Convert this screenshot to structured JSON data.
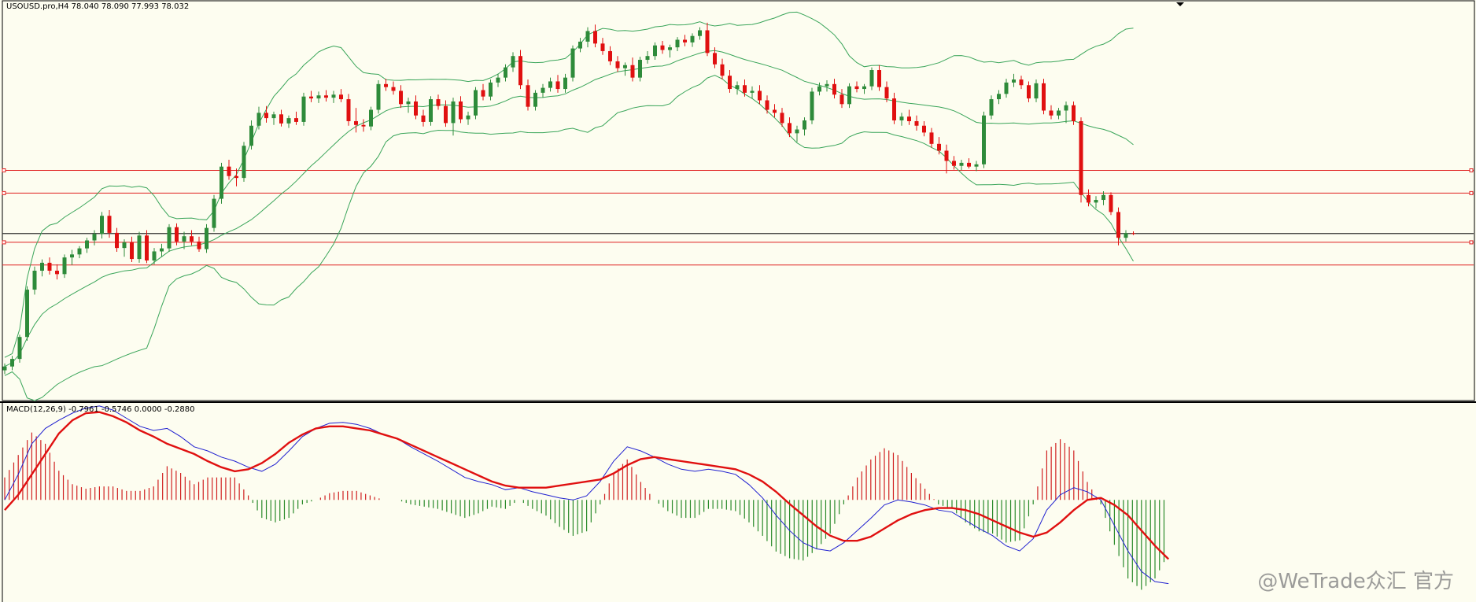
{
  "main_pane": {
    "title": "USOUSD.pro,H4  78.040 78.090 77.993 78.032"
  },
  "macd_pane": {
    "title": "MACD(12,26,9) -0.7961 -0.5746 0.0000 -0.2880"
  },
  "watermark": "@WeTrade众汇 官方",
  "colors": {
    "background": "#fdfdf0",
    "bull_candle": "#2e8b3a",
    "bear_candle": "#e01010",
    "bollinger": "#3aa55a",
    "level_line": "#e02020",
    "current_price_line": "#303030",
    "macd_line": "#2020d0",
    "signal_line": "#e01010",
    "hist_positive": "#d02020",
    "hist_negative": "#2a8a2a"
  },
  "chart_data": [
    {
      "type": "candlestick",
      "title": "USOUSD.pro,H4",
      "last_bar": {
        "open": 78.04,
        "high": 78.09,
        "low": 77.993,
        "close": 78.032
      },
      "ylim": [
        73.6,
        84.2
      ],
      "indicators": [
        "Bollinger Bands"
      ],
      "horizontal_levels": [
        79.7,
        79.1,
        77.8,
        77.2
      ],
      "current_price": 78.032,
      "candles": [
        [
          74.42,
          74.6,
          74.32,
          74.52
        ],
        [
          74.52,
          74.8,
          74.42,
          74.72
        ],
        [
          74.72,
          75.36,
          74.62,
          75.3
        ],
        [
          75.3,
          76.64,
          75.2,
          76.55
        ],
        [
          76.55,
          77.16,
          76.42,
          77.05
        ],
        [
          77.05,
          77.35,
          76.9,
          77.26
        ],
        [
          77.26,
          77.4,
          76.95,
          77.05
        ],
        [
          77.05,
          77.22,
          76.82,
          76.96
        ],
        [
          76.96,
          77.48,
          76.86,
          77.4
        ],
        [
          77.4,
          77.6,
          77.2,
          77.48
        ],
        [
          77.48,
          77.7,
          77.38,
          77.64
        ],
        [
          77.64,
          77.92,
          77.52,
          77.85
        ],
        [
          77.85,
          78.12,
          77.72,
          78.02
        ],
        [
          78.02,
          78.6,
          77.9,
          78.5
        ],
        [
          78.5,
          78.65,
          77.92,
          78.05
        ],
        [
          78.05,
          78.18,
          77.55,
          77.65
        ],
        [
          77.65,
          77.88,
          77.42,
          77.8
        ],
        [
          77.8,
          77.95,
          77.28,
          77.36
        ],
        [
          77.36,
          78.08,
          77.26,
          77.98
        ],
        [
          77.98,
          78.12,
          77.25,
          77.32
        ],
        [
          77.32,
          77.65,
          77.22,
          77.56
        ],
        [
          77.56,
          77.76,
          77.42,
          77.64
        ],
        [
          77.64,
          78.28,
          77.55,
          78.2
        ],
        [
          78.2,
          78.3,
          77.72,
          77.82
        ],
        [
          77.82,
          78.08,
          77.62,
          77.96
        ],
        [
          77.96,
          78.12,
          77.72,
          77.82
        ],
        [
          77.82,
          77.95,
          77.55,
          77.62
        ],
        [
          77.62,
          78.28,
          77.52,
          78.18
        ],
        [
          78.18,
          79.05,
          78.08,
          78.95
        ],
        [
          78.95,
          79.9,
          78.82,
          79.8
        ],
        [
          79.8,
          79.98,
          79.45,
          79.55
        ],
        [
          79.55,
          79.75,
          79.28,
          79.5
        ],
        [
          79.5,
          80.45,
          79.4,
          80.35
        ],
        [
          80.35,
          81.02,
          80.25,
          80.88
        ],
        [
          80.88,
          81.38,
          80.78,
          81.22
        ],
        [
          81.22,
          81.4,
          80.96,
          81.08
        ],
        [
          81.08,
          81.25,
          80.9,
          81.18
        ],
        [
          81.18,
          81.3,
          80.86,
          80.94
        ],
        [
          80.94,
          81.15,
          80.82,
          81.08
        ],
        [
          81.08,
          81.25,
          80.9,
          80.98
        ],
        [
          80.98,
          81.75,
          80.88,
          81.65
        ],
        [
          81.65,
          81.8,
          81.5,
          81.6
        ],
        [
          81.6,
          81.78,
          81.48,
          81.68
        ],
        [
          81.68,
          81.82,
          81.52,
          81.62
        ],
        [
          81.62,
          81.8,
          81.48,
          81.7
        ],
        [
          81.7,
          81.85,
          81.5,
          81.58
        ],
        [
          81.58,
          81.72,
          80.88,
          81.0
        ],
        [
          81.0,
          81.35,
          80.7,
          80.9
        ],
        [
          80.9,
          81.05,
          80.72,
          80.86
        ],
        [
          80.86,
          81.38,
          80.76,
          81.3
        ],
        [
          81.3,
          82.08,
          81.2,
          81.98
        ],
        [
          81.98,
          82.12,
          81.8,
          81.9
        ],
        [
          81.9,
          82.05,
          81.7,
          81.8
        ],
        [
          81.8,
          81.95,
          81.35,
          81.45
        ],
        [
          81.45,
          81.62,
          81.22,
          81.52
        ],
        [
          81.52,
          81.68,
          81.05,
          81.15
        ],
        [
          81.15,
          81.3,
          80.86,
          80.98
        ],
        [
          80.98,
          81.66,
          80.88,
          81.58
        ],
        [
          81.58,
          81.7,
          81.3,
          81.4
        ],
        [
          81.4,
          81.55,
          80.85,
          80.95
        ],
        [
          80.95,
          81.62,
          80.62,
          81.52
        ],
        [
          81.52,
          81.66,
          80.95,
          81.05
        ],
        [
          81.05,
          81.25,
          80.9,
          81.15
        ],
        [
          81.15,
          81.9,
          81.05,
          81.82
        ],
        [
          81.82,
          81.98,
          81.55,
          81.65
        ],
        [
          81.65,
          82.1,
          81.55,
          82.02
        ],
        [
          82.02,
          82.25,
          81.9,
          82.15
        ],
        [
          82.15,
          82.5,
          82.05,
          82.42
        ],
        [
          82.42,
          82.82,
          82.3,
          82.72
        ],
        [
          82.72,
          82.88,
          81.85,
          81.95
        ],
        [
          81.95,
          82.1,
          81.28,
          81.38
        ],
        [
          81.38,
          81.82,
          81.28,
          81.75
        ],
        [
          81.75,
          81.98,
          81.62,
          81.88
        ],
        [
          81.88,
          82.15,
          81.78,
          82.05
        ],
        [
          82.05,
          82.22,
          81.75,
          81.85
        ],
        [
          81.85,
          82.25,
          81.75,
          82.15
        ],
        [
          82.15,
          83.0,
          82.05,
          82.92
        ],
        [
          82.92,
          83.2,
          82.82,
          83.1
        ],
        [
          83.1,
          83.48,
          82.95,
          83.38
        ],
        [
          83.38,
          83.55,
          82.95,
          83.05
        ],
        [
          83.05,
          83.2,
          82.75,
          82.85
        ],
        [
          82.85,
          82.98,
          82.48,
          82.58
        ],
        [
          82.58,
          82.72,
          82.3,
          82.4
        ],
        [
          82.4,
          82.55,
          82.2,
          82.48
        ],
        [
          82.48,
          82.68,
          82.05,
          82.15
        ],
        [
          82.15,
          82.7,
          82.05,
          82.62
        ],
        [
          82.62,
          82.85,
          82.52,
          82.72
        ],
        [
          82.72,
          83.08,
          82.62,
          83.0
        ],
        [
          83.0,
          83.12,
          82.78,
          82.88
        ],
        [
          82.88,
          83.02,
          82.68,
          82.95
        ],
        [
          82.95,
          83.22,
          82.85,
          83.15
        ],
        [
          83.15,
          83.28,
          82.98,
          83.08
        ],
        [
          83.08,
          83.32,
          82.96,
          83.25
        ],
        [
          83.25,
          83.48,
          83.15,
          83.4
        ],
        [
          83.4,
          83.6,
          82.72,
          82.8
        ],
        [
          82.8,
          82.95,
          82.4,
          82.5
        ],
        [
          82.5,
          82.65,
          82.1,
          82.2
        ],
        [
          82.2,
          82.35,
          81.75,
          81.85
        ],
        [
          81.85,
          82.05,
          81.7,
          81.95
        ],
        [
          81.95,
          82.1,
          81.65,
          81.75
        ],
        [
          81.75,
          81.92,
          81.6,
          81.8
        ],
        [
          81.8,
          81.95,
          81.45,
          81.55
        ],
        [
          81.55,
          81.68,
          81.2,
          81.3
        ],
        [
          81.3,
          81.45,
          81.1,
          81.22
        ],
        [
          81.22,
          81.35,
          80.85,
          80.95
        ],
        [
          80.95,
          81.1,
          80.58,
          80.68
        ],
        [
          80.68,
          80.88,
          80.45,
          80.78
        ],
        [
          80.78,
          81.1,
          80.62,
          81.02
        ],
        [
          81.02,
          81.88,
          80.92,
          81.78
        ],
        [
          81.78,
          82.02,
          81.68,
          81.92
        ],
        [
          81.92,
          82.08,
          81.78,
          81.98
        ],
        [
          81.98,
          82.12,
          81.6,
          81.7
        ],
        [
          81.7,
          81.85,
          81.35,
          81.45
        ],
        [
          81.45,
          82.0,
          81.35,
          81.92
        ],
        [
          81.92,
          82.05,
          81.76,
          81.85
        ],
        [
          81.85,
          81.98,
          81.72,
          81.92
        ],
        [
          81.92,
          82.42,
          81.82,
          82.35
        ],
        [
          82.35,
          82.48,
          81.8,
          81.9
        ],
        [
          81.9,
          82.05,
          81.5,
          81.6
        ],
        [
          81.6,
          81.75,
          80.92,
          81.02
        ],
        [
          81.02,
          81.22,
          80.88,
          81.12
        ],
        [
          81.12,
          81.3,
          80.9,
          81.0
        ],
        [
          81.0,
          81.15,
          80.75,
          80.88
        ],
        [
          80.88,
          81.0,
          80.6,
          80.7
        ],
        [
          80.7,
          80.82,
          80.3,
          80.4
        ],
        [
          80.4,
          80.58,
          80.12,
          80.22
        ],
        [
          80.22,
          80.38,
          79.62,
          79.95
        ],
        [
          79.95,
          80.08,
          79.72,
          79.82
        ],
        [
          79.82,
          79.98,
          79.7,
          79.9
        ],
        [
          79.9,
          80.02,
          79.75,
          79.8
        ],
        [
          79.8,
          79.95,
          79.68,
          79.86
        ],
        [
          79.86,
          81.25,
          79.76,
          81.15
        ],
        [
          81.15,
          81.68,
          81.05,
          81.58
        ],
        [
          81.58,
          81.82,
          81.45,
          81.72
        ],
        [
          81.72,
          82.12,
          81.62,
          82.02
        ],
        [
          82.02,
          82.25,
          81.9,
          82.1
        ],
        [
          82.1,
          82.2,
          81.85,
          81.95
        ],
        [
          81.95,
          82.05,
          81.5,
          81.6
        ],
        [
          81.6,
          82.1,
          81.5,
          82.0
        ],
        [
          82.0,
          82.12,
          81.18,
          81.28
        ],
        [
          81.28,
          81.42,
          81.05,
          81.15
        ],
        [
          81.15,
          81.35,
          81.05,
          81.28
        ],
        [
          81.28,
          81.52,
          80.95,
          81.42
        ],
        [
          81.42,
          81.52,
          80.9,
          81.0
        ],
        [
          81.0,
          81.1,
          78.85,
          79.05
        ],
        [
          79.05,
          79.2,
          78.75,
          78.85
        ],
        [
          78.85,
          79.02,
          78.7,
          78.92
        ],
        [
          78.92,
          79.15,
          78.78,
          79.05
        ],
        [
          79.05,
          79.12,
          78.52,
          78.6
        ],
        [
          78.6,
          78.72,
          77.72,
          77.92
        ],
        [
          77.92,
          78.12,
          77.82,
          78.04
        ],
        [
          78.04,
          78.09,
          77.99,
          78.03
        ]
      ]
    },
    {
      "type": "macd",
      "title": "MACD(12,26,9)",
      "values": {
        "macd": -0.7961,
        "signal": -0.5746,
        "zero": 0.0,
        "histogram": -0.288
      },
      "ylim": [
        -1.0,
        0.95
      ],
      "macd_line": [
        0.0,
        0.25,
        0.55,
        0.7,
        0.78,
        0.85,
        0.9,
        0.92,
        0.88,
        0.8,
        0.72,
        0.68,
        0.7,
        0.62,
        0.52,
        0.48,
        0.42,
        0.38,
        0.32,
        0.28,
        0.35,
        0.48,
        0.62,
        0.7,
        0.75,
        0.76,
        0.74,
        0.7,
        0.64,
        0.6,
        0.52,
        0.45,
        0.38,
        0.3,
        0.22,
        0.18,
        0.15,
        0.1,
        0.12,
        0.08,
        0.05,
        0.02,
        0.0,
        0.04,
        0.18,
        0.38,
        0.52,
        0.48,
        0.42,
        0.35,
        0.3,
        0.28,
        0.3,
        0.28,
        0.25,
        0.15,
        0.02,
        -0.15,
        -0.3,
        -0.42,
        -0.48,
        -0.5,
        -0.42,
        -0.3,
        -0.18,
        -0.05,
        0.0,
        -0.02,
        -0.05,
        -0.1,
        -0.12,
        -0.2,
        -0.28,
        -0.35,
        -0.45,
        -0.5,
        -0.38,
        -0.1,
        0.05,
        0.12,
        0.08,
        0.0,
        -0.25,
        -0.5,
        -0.7,
        -0.8,
        -0.82
      ],
      "signal_line": [
        -0.1,
        0.05,
        0.25,
        0.45,
        0.65,
        0.78,
        0.85,
        0.86,
        0.82,
        0.76,
        0.68,
        0.62,
        0.55,
        0.5,
        0.45,
        0.38,
        0.32,
        0.28,
        0.3,
        0.36,
        0.45,
        0.56,
        0.64,
        0.7,
        0.72,
        0.72,
        0.7,
        0.68,
        0.64,
        0.6,
        0.54,
        0.48,
        0.42,
        0.36,
        0.3,
        0.24,
        0.18,
        0.14,
        0.12,
        0.12,
        0.12,
        0.14,
        0.16,
        0.18,
        0.2,
        0.26,
        0.34,
        0.4,
        0.42,
        0.4,
        0.38,
        0.36,
        0.34,
        0.32,
        0.3,
        0.25,
        0.18,
        0.08,
        -0.04,
        -0.15,
        -0.26,
        -0.35,
        -0.4,
        -0.4,
        -0.36,
        -0.28,
        -0.2,
        -0.14,
        -0.1,
        -0.08,
        -0.08,
        -0.1,
        -0.14,
        -0.2,
        -0.26,
        -0.32,
        -0.36,
        -0.32,
        -0.22,
        -0.1,
        0.0,
        0.02,
        -0.05,
        -0.15,
        -0.3,
        -0.45,
        -0.58
      ]
    }
  ]
}
